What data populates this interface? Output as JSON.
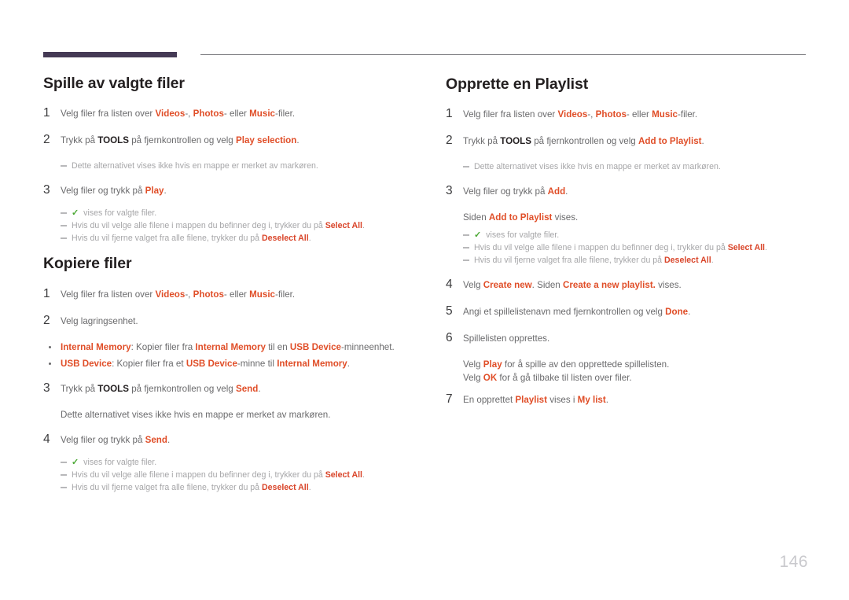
{
  "document": {
    "page_number": "146",
    "accent_color": "#e04e28",
    "rule_color": "#453a55",
    "check_color": "#4aa833"
  },
  "left_column": {
    "section1": {
      "title": "Spille av valgte filer",
      "steps": [
        {
          "num": "1",
          "text_html": "Velg filer fra listen over <b class=\"a\">Videos</b>-, <b class=\"a\">Photos</b>- eller <b class=\"a\">Music</b>-filer."
        },
        {
          "num": "2",
          "text_html": "Trykk på <b class=\"k\">TOOLS</b> på fjernkontrollen og velg <b class=\"a\">Play selection</b>."
        }
      ],
      "note_after_step2": "Dette alternativet vises ikke hvis en mappe er merket av markøren.",
      "step3": {
        "num": "3",
        "text_html": "Velg filer og trykk på <b class=\"a\">Play</b>."
      },
      "notes": [
        {
          "check": true,
          "text_html": "vises for valgte filer."
        },
        {
          "check": false,
          "text_html": "Hvis du vil velge alle filene i mappen du befinner deg i, trykker du på <b class=\"a\">Select All</b>."
        },
        {
          "check": false,
          "text_html": "Hvis du vil fjerne valget fra alle filene, trykker du på <b class=\"a\">Deselect All</b>."
        }
      ]
    },
    "section2": {
      "title": "Kopiere filer",
      "steps": [
        {
          "num": "1",
          "text_html": "Velg filer fra listen over <b class=\"a\">Videos</b>-, <b class=\"a\">Photos</b>- eller <b class=\"a\">Music</b>-filer."
        },
        {
          "num": "2",
          "text_html": "Velg lagringsenhet."
        }
      ],
      "bullets": [
        {
          "text_html": "<b class=\"a\">Internal Memory</b>: Kopier filer fra <b class=\"a\">Internal Memory</b> til en <b class=\"a\">USB Device</b>-minneenhet."
        },
        {
          "text_html": "<b class=\"a\">USB Device</b>: Kopier filer fra et <b class=\"a\">USB Device</b>-minne til <b class=\"a\">Internal Memory</b>."
        }
      ],
      "step3": {
        "num": "3",
        "text_html": "Trykk på <b class=\"k\">TOOLS</b> på fjernkontrollen og velg <b class=\"a\">Send</b>."
      },
      "para_after_step3": "Dette alternativet vises ikke hvis en mappe er merket av markøren.",
      "step4": {
        "num": "4",
        "text_html": "Velg filer og trykk på <b class=\"a\">Send</b>."
      },
      "notes": [
        {
          "check": true,
          "text_html": "vises for valgte filer."
        },
        {
          "check": false,
          "text_html": "Hvis du vil velge alle filene i mappen du befinner deg i, trykker du på <b class=\"a\">Select All</b>."
        },
        {
          "check": false,
          "text_html": "Hvis du vil fjerne valget fra alle filene, trykker du på <b class=\"a\">Deselect All</b>."
        }
      ]
    }
  },
  "right_column": {
    "section1": {
      "title": "Opprette en Playlist",
      "steps": [
        {
          "num": "1",
          "text_html": "Velg filer fra listen over <b class=\"a\">Videos</b>-, <b class=\"a\">Photos</b>- eller <b class=\"a\">Music</b>-filer."
        },
        {
          "num": "2",
          "text_html": "Trykk på <b class=\"k\">TOOLS</b> på fjernkontrollen og velg <b class=\"a\">Add to Playlist</b>."
        }
      ],
      "note_after_step2": "Dette alternativet vises ikke hvis en mappe er merket av markøren.",
      "step3": {
        "num": "3",
        "text_html": "Velg filer og trykk på <b class=\"a\">Add</b>."
      },
      "para_after_step3_html": "Siden <b class=\"a\">Add to Playlist</b> vises.",
      "notes": [
        {
          "check": true,
          "text_html": "vises for valgte filer."
        },
        {
          "check": false,
          "text_html": "Hvis du vil velge alle filene i mappen du befinner deg i, trykker du på <b class=\"a\">Select All</b>."
        },
        {
          "check": false,
          "text_html": "Hvis du vil fjerne valget fra alle filene, trykker du på <b class=\"a\">Deselect All</b>."
        }
      ],
      "steps_rest": [
        {
          "num": "4",
          "text_html": "Velg <b class=\"a\">Create new</b>. Siden <b class=\"a\">Create a new playlist.</b> vises."
        },
        {
          "num": "5",
          "text_html": "Angi et spillelistenavn med fjernkontrollen og velg <b class=\"a\">Done</b>."
        },
        {
          "num": "6",
          "text_html": "Spillelisten opprettes."
        }
      ],
      "para_after_step6_line1_html": "Velg <b class=\"a\">Play</b> for å spille av den opprettede spillelisten.",
      "para_after_step6_line2_html": "Velg <b class=\"a\">OK</b> for å gå tilbake til listen over filer.",
      "step7": {
        "num": "7",
        "text_html": "En opprettet <b class=\"a\">Playlist</b> vises i <b class=\"a\">My list</b>."
      }
    }
  }
}
